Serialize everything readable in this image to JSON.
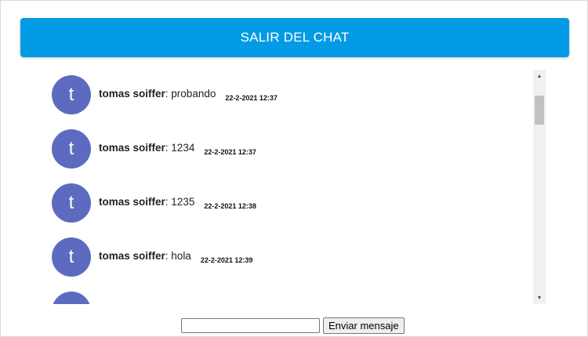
{
  "header": {
    "exit_label": "SALIR DEL CHAT",
    "accent_color": "#039be5"
  },
  "messages": [
    {
      "avatar_letter": "t",
      "sender": "tomas soiffer",
      "separator": ": ",
      "text": "probando",
      "time": "22-2-2021 12:37"
    },
    {
      "avatar_letter": "t",
      "sender": "tomas soiffer",
      "separator": ": ",
      "text": "1234",
      "time": "22-2-2021 12:37"
    },
    {
      "avatar_letter": "t",
      "sender": "tomas soiffer",
      "separator": ": ",
      "text": "1235",
      "time": "22-2-2021 12:38"
    },
    {
      "avatar_letter": "t",
      "sender": "tomas soiffer",
      "separator": ": ",
      "text": "hola",
      "time": "22-2-2021 12:39"
    },
    {
      "avatar_letter": "t",
      "sender": "",
      "separator": "",
      "text": "",
      "time": ""
    }
  ],
  "avatar_color": "#5c6bc0",
  "composer": {
    "input_value": "",
    "send_label": "Enviar mensaje"
  },
  "scrollbar": {
    "up_icon": "arrow-up-icon",
    "down_icon": "arrow-down-icon"
  }
}
